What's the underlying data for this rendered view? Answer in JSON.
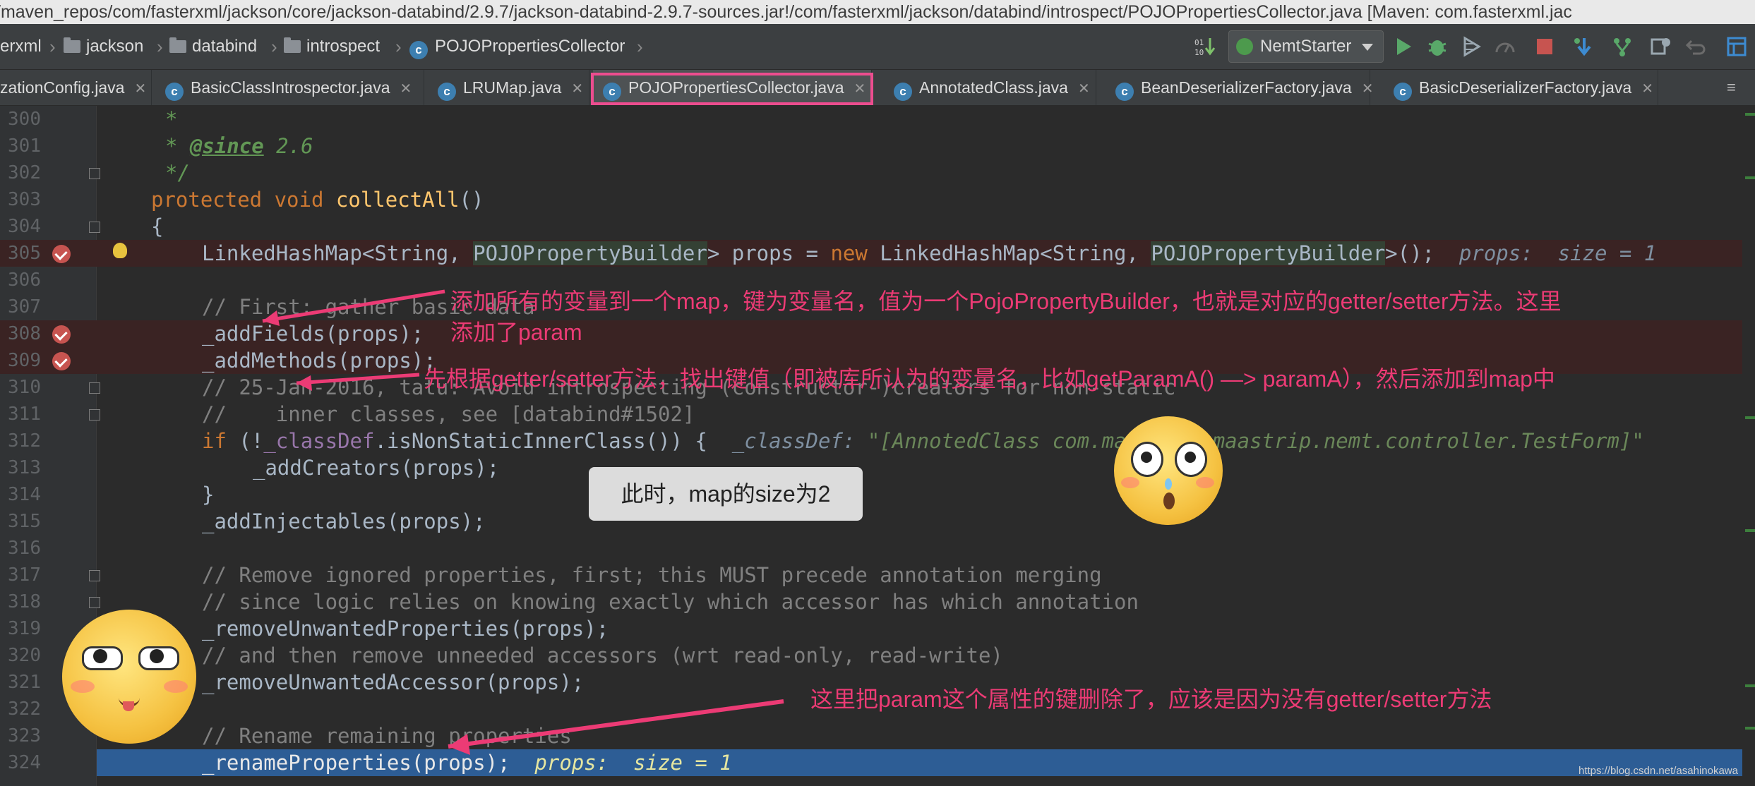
{
  "title_bar": {
    "path": "/maven_repos/com/fasterxml/jackson/core/jackson-databind/2.9.7/jackson-databind-2.9.7-sources.jar!/com/fasterxml/jackson/databind/introspect/POJOPropertiesCollector.java [Maven: com.fasterxml.jac"
  },
  "nav": {
    "crumbs": [
      "erxml",
      "jackson",
      "databind",
      "introspect",
      "POJOPropertiesCollector"
    ],
    "run_config": "NemtStarter"
  },
  "tabs": [
    {
      "label": "zationConfig.java"
    },
    {
      "label": "BasicClassIntrospector.java"
    },
    {
      "label": "LRUMap.java"
    },
    {
      "label": "POJOPropertiesCollector.java"
    },
    {
      "label": "AnnotatedClass.java"
    },
    {
      "label": "BeanDeserializerFactory.java"
    },
    {
      "label": "BasicDeserializerFactory.java"
    }
  ],
  "line_numbers": [
    "300",
    "301",
    "302",
    "303",
    "304",
    "305",
    "306",
    "307",
    "308",
    "309",
    "310",
    "311",
    "312",
    "313",
    "314",
    "315",
    "316",
    "317",
    "318",
    "319",
    "320",
    "321",
    "322",
    "323",
    "324"
  ],
  "code": {
    "l300": "*",
    "l301_star": "* ",
    "l301_tag": "@since",
    "l301_rest": " 2.6",
    "l302": "*/",
    "l303_kw": "protected void ",
    "l303_fn": "collectAll",
    "l303_rest": "()",
    "l304": "{",
    "l305_a": "LinkedHashMap<String, ",
    "l305_b": "POJOPropertyBuilder",
    "l305_c": "> props = ",
    "l305_kw": "new",
    "l305_d": " LinkedHashMap<String, ",
    "l305_e": "POJOPropertyBuilder",
    "l305_f": ">();",
    "l305_inline": "  props:  size = 1",
    "l307": "// First: gather basic data",
    "l308": "_addFields(props);",
    "l309": "_addMethods(props);",
    "l310": "// 25-Jan-2016, tatu: Avoid introspecting (constructor-)creators for non-static",
    "l311": "//    inner classes, see [databind#1502]",
    "l312_kw": "if",
    "l312_a": " (!",
    "l312_fld": "_classDef",
    "l312_b": ".isNonStaticInnerClass()) {",
    "l312_inline_name": "  _classDef: ",
    "l312_inline_val": "\"[AnnotedClass com.maastrip.maastrip.nemt.controller.TestForm]\"",
    "l313": "_addCreators(props);",
    "l314": "}",
    "l315": "_addInjectables(props);",
    "l317": "// Remove ignored properties, first; this MUST precede annotation merging",
    "l318": "// since logic relies on knowing exactly which accessor has which annotation",
    "l319": "_removeUnwantedProperties(props);",
    "l320": "// and then remove unneeded accessors (wrt read-only, read-write)",
    "l321": "_removeUnwantedAccessor(props);",
    "l323": "// Rename remaining properties",
    "l324": "_renameProperties(props);",
    "l324_inline": "  props:  size = 1"
  },
  "annotations": {
    "note1_line1": "添加所有的变量到一个map，键为变量名，值为一个PojoPropertyBuilder，也就是对应的getter/setter方法。这里",
    "note1_line2": "添加了param",
    "note2": "先根据getter/setter方法，找出键值（即被库所认为的变量名，比如getParamA() —> paramA），然后添加到map中",
    "tooltip": "此时，map的size为2",
    "note3": "这里把param这个属性的键删除了，应该是因为没有getter/setter方法"
  },
  "watermark": "https://blog.csdn.net/asahinokawa",
  "colors": {
    "annotation": "#ec3b75",
    "breakpoint": "#c75450",
    "current_line": "#2d5d95",
    "keyword": "#cc7832",
    "method_decl": "#ffc66d",
    "field": "#9876aa",
    "comment": "#808080",
    "javadoc": "#629755"
  }
}
